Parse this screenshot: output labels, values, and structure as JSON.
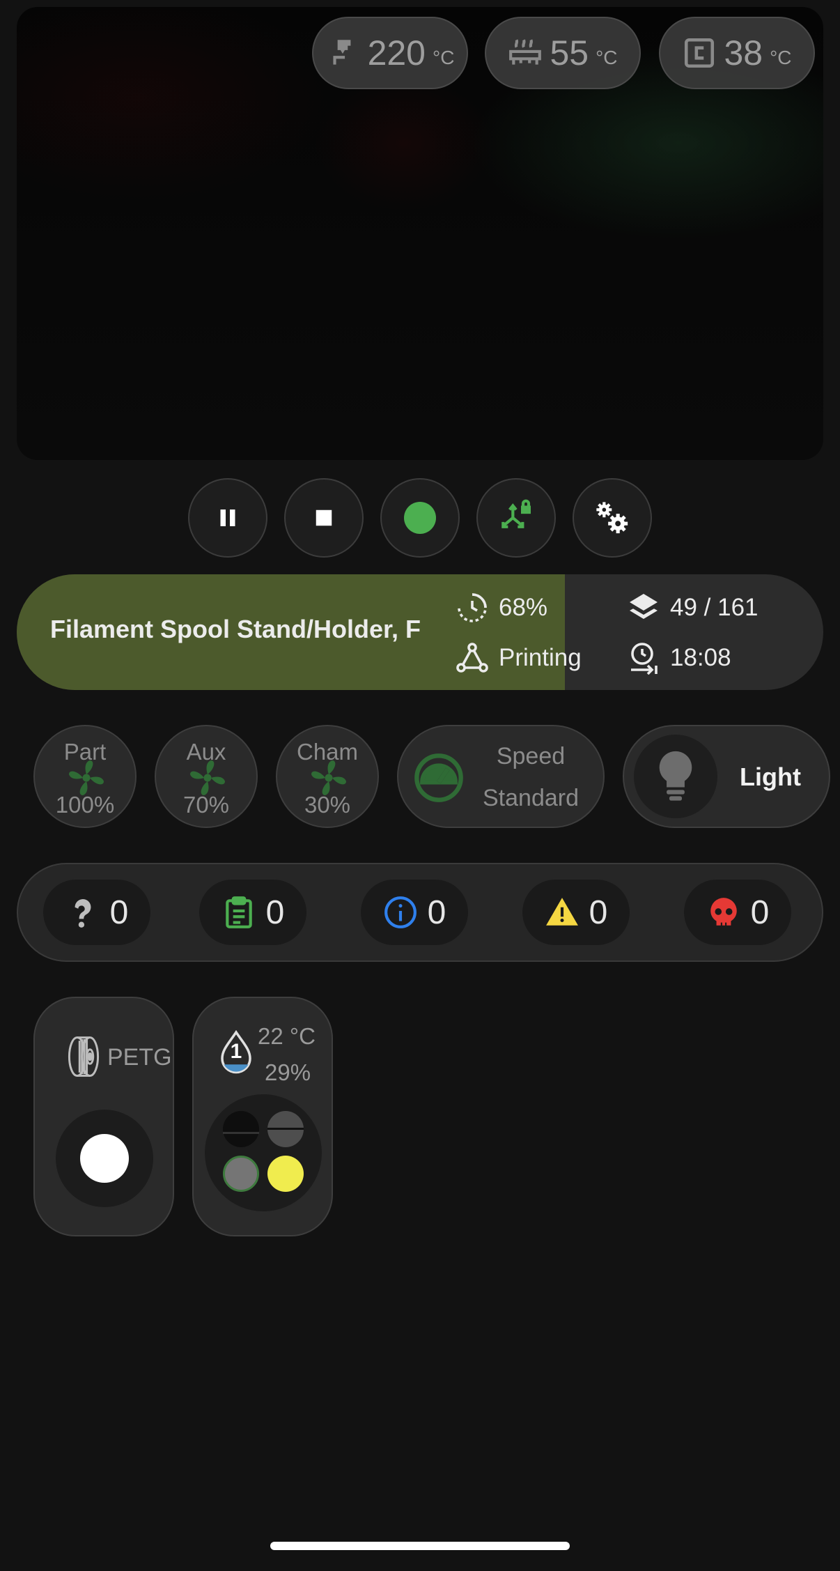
{
  "camera": {
    "temps": [
      {
        "icon": "nozzle-icon",
        "value": "220",
        "unit": "°C"
      },
      {
        "icon": "heated-bed-icon",
        "value": "55",
        "unit": "°C"
      },
      {
        "icon": "chamber-icon",
        "value": "38",
        "unit": "°C"
      }
    ]
  },
  "controls": [
    {
      "name": "pause-button",
      "icon": "pause-icon"
    },
    {
      "name": "stop-button",
      "icon": "stop-icon"
    },
    {
      "name": "status-light-button",
      "icon": "status-dot-icon"
    },
    {
      "name": "axis-lock-button",
      "icon": "axis-lock-icon"
    },
    {
      "name": "settings-button",
      "icon": "gears-icon"
    }
  ],
  "job": {
    "title": "Filament Spool Stand/Holder, F",
    "progress": "68%",
    "progress_fraction": 0.68,
    "status": "Printing",
    "layers": "49 / 161",
    "remaining": "18:08"
  },
  "fans": [
    {
      "name": "Part",
      "value": "100%"
    },
    {
      "name": "Aux",
      "value": "70%"
    },
    {
      "name": "Cham",
      "value": "30%"
    }
  ],
  "speed": {
    "label": "Speed",
    "mode": "Standard"
  },
  "light": {
    "label": "Light"
  },
  "notifications": [
    {
      "icon": "question-icon",
      "count": "0",
      "color": "#bdbdbd"
    },
    {
      "icon": "clipboard-icon",
      "count": "0",
      "color": "#4caf50"
    },
    {
      "icon": "info-icon",
      "count": "0",
      "color": "#2f80ed"
    },
    {
      "icon": "warning-icon",
      "count": "0",
      "color": "#f5d742"
    },
    {
      "icon": "skull-icon",
      "count": "0",
      "color": "#e53935"
    }
  ],
  "spool": {
    "material": "PETG",
    "color": "#ffffff"
  },
  "dryer": {
    "slot_number": "1",
    "temperature": "22 °C",
    "humidity": "29%",
    "slot_colors": [
      "#111111",
      "#555555",
      "#777777",
      "#f0ec4e"
    ]
  },
  "colors": {
    "accent_green": "#4caf50",
    "progress_fill": "#4c5a2c",
    "background": "#121212"
  }
}
